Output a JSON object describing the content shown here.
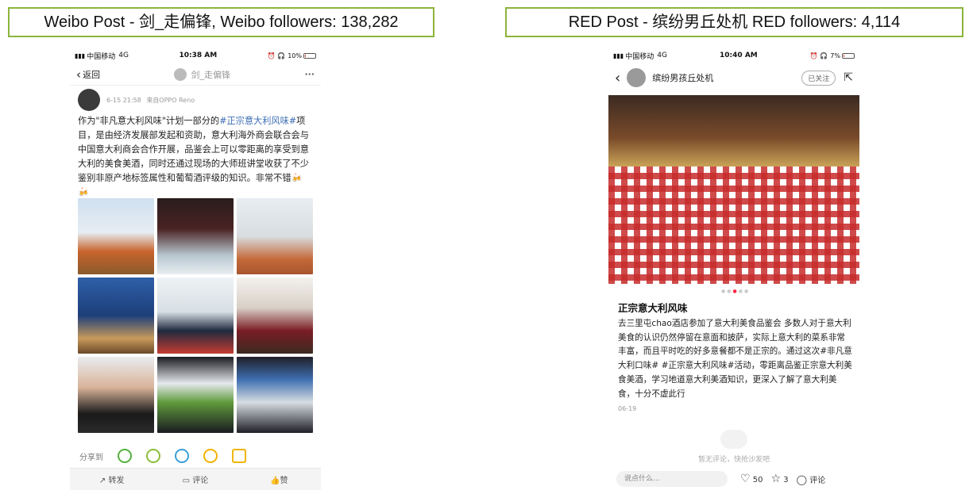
{
  "captions": {
    "weibo": "Weibo Post - 剑_走偏锋, Weibo followers: 138,282",
    "red": "RED Post - 缤纷男丘处机 RED followers: 4,114"
  },
  "weibo": {
    "status": {
      "carrier": "中国移动",
      "network": "4G",
      "time": "10:38 AM",
      "battery": "10%"
    },
    "nav": {
      "back_label": "返回",
      "account": "剑_走偏锋",
      "more": "···"
    },
    "post_meta": {
      "date": "6-15 21:58",
      "source": "来自OPPO Reno"
    },
    "body": {
      "p1": "作为\"非凡意大利风味\"计划一部分的",
      "tag1": "#正宗意大利风味#",
      "p2": "项目，是由经济发展部发起和资助，意大利海外商会联合会与中国意大利商会合作开展，品鉴会上可以零距离的享受到意大利的美食美酒，同时还通过现场的大师班讲堂收获了不少鉴别非原产地标签属性和葡萄酒评级的知识。非常不错🍻🍻"
    },
    "share_label": "分享到",
    "actions": {
      "repost": "转发",
      "comment": "评论",
      "like": "赞"
    }
  },
  "red": {
    "status": {
      "carrier": "中国移动",
      "network": "4G",
      "time": "10:40 AM",
      "battery": "7%"
    },
    "nav": {
      "account": "缤纷男孩丘处机",
      "follow": "已关注"
    },
    "title": "正宗意大利风味",
    "body": "去三里屯chao酒店参加了意大利美食品鉴会 多数人对于意大利美食的认识仍然停留在意面和披萨，实际上意大利的菜系非常丰富，而且平时吃的好多意餐都不是正宗的。通过这次#非凡意大利口味# #正宗意大利风味#活动，零距离品鉴正宗意大利美食美酒，学习地道意大利美酒知识，更深入了解了意大利美食，十分不虚此行",
    "date": "06-19",
    "no_comment": "暂无评论，快抢沙发吧",
    "input_placeholder": "说点什么...",
    "likes": "50",
    "stars": "3",
    "comment_label": "评论"
  },
  "colors": {
    "caption_border": "#8cb43c",
    "weibo_link": "#3b6db3",
    "red_check": "#c72b2b"
  }
}
